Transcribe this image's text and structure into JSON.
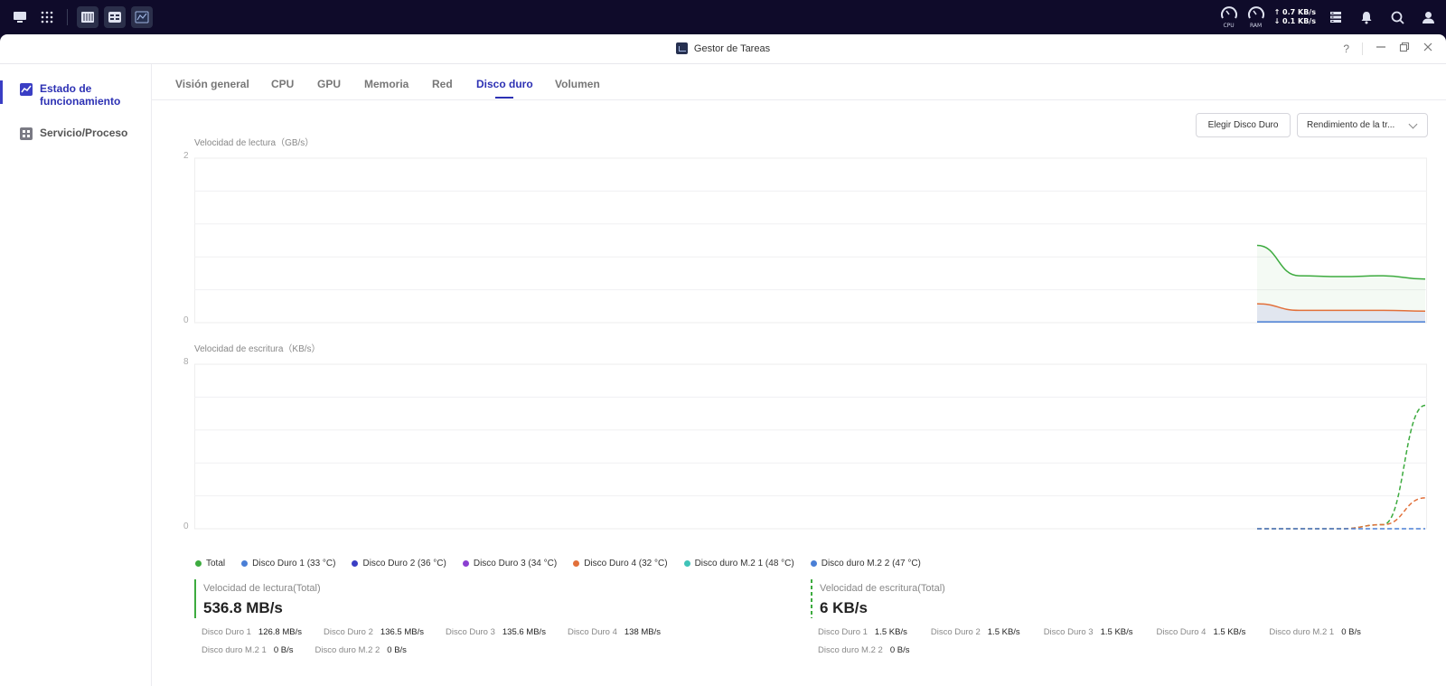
{
  "sysbar": {
    "cpu_label": "CPU",
    "ram_label": "RAM",
    "net_up": "↑ 0.7 KB/s",
    "net_down": "↓ 0.1 KB/s"
  },
  "window": {
    "title": "Gestor de Tareas",
    "help": "?"
  },
  "sidebar": {
    "items": [
      {
        "label": "Estado de funcionamiento",
        "icon": "chart-line-icon",
        "active": true
      },
      {
        "label": "Servicio/Proceso",
        "icon": "process-icon",
        "active": false
      }
    ]
  },
  "tabs": [
    {
      "label": "Visión general"
    },
    {
      "label": "CPU"
    },
    {
      "label": "GPU"
    },
    {
      "label": "Memoria"
    },
    {
      "label": "Red"
    },
    {
      "label": "Disco duro",
      "active": true
    },
    {
      "label": "Volumen"
    }
  ],
  "controls": {
    "choose_disk": "Elegir Disco Duro",
    "performance_select": "Rendimiento de la tr..."
  },
  "chart_data": [
    {
      "type": "line",
      "title": "Velocidad de lectura（GB/s）",
      "ylim": [
        0,
        2
      ],
      "yticks": [
        "2",
        "0"
      ],
      "series": [
        {
          "name": "Total",
          "color": "#3dab3f",
          "values": [
            0.94,
            0.57,
            0.56,
            0.57,
            0.53
          ]
        },
        {
          "name": "Disco Duro 4 (32 °C)",
          "color": "#e2703a",
          "values": [
            0.23,
            0.15,
            0.15,
            0.15,
            0.14
          ]
        },
        {
          "name": "Disco Duro 1 (33 °C)",
          "color": "#4a7fd6",
          "values": [
            0.01,
            0.01,
            0.01,
            0.01,
            0.01
          ]
        }
      ]
    },
    {
      "type": "line",
      "title": "Velocidad de escritura（KB/s）",
      "ylim": [
        0,
        8
      ],
      "yticks": [
        "8",
        "0"
      ],
      "series": [
        {
          "name": "Total",
          "color": "#3dab3f",
          "values": [
            0,
            0,
            0,
            0.2,
            6
          ]
        },
        {
          "name": "Disco Duro 4 (32 °C)",
          "color": "#e2703a",
          "values": [
            0,
            0,
            0,
            0.2,
            1.5
          ]
        },
        {
          "name": "Disco Duro 1 (33 °C)",
          "color": "#4a7fd6",
          "values": [
            0,
            0,
            0,
            0,
            0
          ]
        }
      ]
    }
  ],
  "legend": [
    {
      "label": "Total",
      "color": "#3dab3f"
    },
    {
      "label": "Disco Duro 1 (33 °C)",
      "color": "#4a7fd6"
    },
    {
      "label": "Disco Duro 2 (36 °C)",
      "color": "#3a3ec4"
    },
    {
      "label": "Disco Duro 3 (34 °C)",
      "color": "#8b3fd1"
    },
    {
      "label": "Disco Duro 4 (32 °C)",
      "color": "#e2703a"
    },
    {
      "label": "Disco duro M.2 1 (48 °C)",
      "color": "#3fc3b8"
    },
    {
      "label": "Disco duro M.2 2 (47 °C)",
      "color": "#4a7fd6"
    }
  ],
  "read_summary": {
    "title": "Velocidad de lectura(Total)",
    "value": "536.8 MB/s",
    "color": "#3dab3f",
    "disks": [
      {
        "name": "Disco Duro 1",
        "value": "126.8 MB/s"
      },
      {
        "name": "Disco Duro 2",
        "value": "136.5 MB/s"
      },
      {
        "name": "Disco Duro 3",
        "value": "135.6 MB/s"
      },
      {
        "name": "Disco Duro 4",
        "value": "138 MB/s"
      },
      {
        "name": "Disco duro M.2 1",
        "value": "0 B/s"
      },
      {
        "name": "Disco duro M.2 2",
        "value": "0 B/s"
      }
    ]
  },
  "write_summary": {
    "title": "Velocidad de escritura(Total)",
    "value": "6 KB/s",
    "color": "#3dab3f",
    "disks": [
      {
        "name": "Disco Duro 1",
        "value": "1.5 KB/s"
      },
      {
        "name": "Disco Duro 2",
        "value": "1.5 KB/s"
      },
      {
        "name": "Disco Duro 3",
        "value": "1.5 KB/s"
      },
      {
        "name": "Disco Duro 4",
        "value": "1.5 KB/s"
      },
      {
        "name": "Disco duro M.2 1",
        "value": "0 B/s"
      },
      {
        "name": "Disco duro M.2 2",
        "value": "0 B/s"
      }
    ]
  }
}
